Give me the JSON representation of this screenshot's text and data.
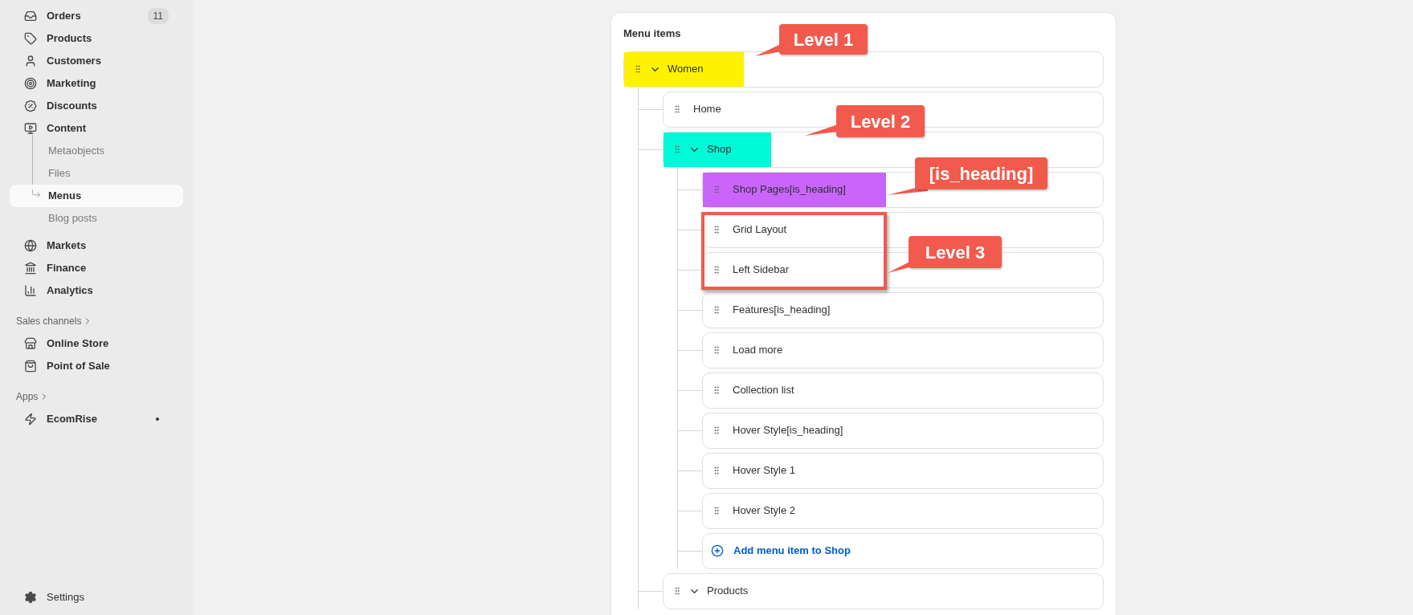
{
  "sidebar": {
    "main_items": [
      {
        "label": "Orders",
        "badge": "11",
        "selected": false
      },
      {
        "label": "Products",
        "selected": false
      },
      {
        "label": "Customers",
        "selected": false
      },
      {
        "label": "Marketing",
        "selected": false
      },
      {
        "label": "Discounts",
        "selected": false
      },
      {
        "label": "Content",
        "selected": false,
        "children": [
          {
            "label": "Metaobjects",
            "selected": false
          },
          {
            "label": "Files",
            "selected": false
          },
          {
            "label": "Menus",
            "selected": true
          },
          {
            "label": "Blog posts",
            "selected": false
          }
        ]
      },
      {
        "label": "Markets",
        "selected": false
      },
      {
        "label": "Finance",
        "selected": false
      },
      {
        "label": "Analytics",
        "selected": false
      }
    ],
    "sales_channels": {
      "label": "Sales channels",
      "items": [
        {
          "label": "Online Store",
          "selected": false
        },
        {
          "label": "Point of Sale",
          "selected": false
        }
      ]
    },
    "apps": {
      "label": "Apps",
      "items": [
        {
          "label": "EcomRise",
          "selected": false,
          "dot": true
        }
      ]
    },
    "settings": {
      "label": "Settings"
    }
  },
  "menu_items": {
    "title": "Menu items",
    "items": [
      {
        "kind": "link",
        "label": "Women",
        "expanded": true,
        "color": "#fff200",
        "children": [
          {
            "kind": "link",
            "label": "Home"
          },
          {
            "kind": "link",
            "label": "Shop",
            "expanded": true,
            "color": "#00f9d6",
            "children": [
              {
                "kind": "link",
                "label": "Shop Pages[is_heading]",
                "color": "#c965fb"
              },
              {
                "kind": "link",
                "label": "Grid Layout"
              },
              {
                "kind": "link",
                "label": "Left Sidebar"
              },
              {
                "kind": "link",
                "label": "Features[is_heading]"
              },
              {
                "kind": "link",
                "label": "Load more"
              },
              {
                "kind": "link",
                "label": "Collection list"
              },
              {
                "kind": "link",
                "label": "Hover Style[is_heading]"
              },
              {
                "kind": "link",
                "label": "Hover Style 1"
              },
              {
                "kind": "link",
                "label": "Hover Style 2"
              },
              {
                "kind": "add",
                "label": "Add menu item to Shop"
              }
            ]
          },
          {
            "kind": "link",
            "label": "Products",
            "expanded": true
          }
        ]
      }
    ]
  },
  "annotations": [
    {
      "kind": "callout",
      "text": "Level 1"
    },
    {
      "kind": "callout",
      "text": "Level 2"
    },
    {
      "kind": "callout",
      "text": "[is_heading]"
    },
    {
      "kind": "frame"
    },
    {
      "kind": "callout",
      "text": "Level 3"
    }
  ]
}
